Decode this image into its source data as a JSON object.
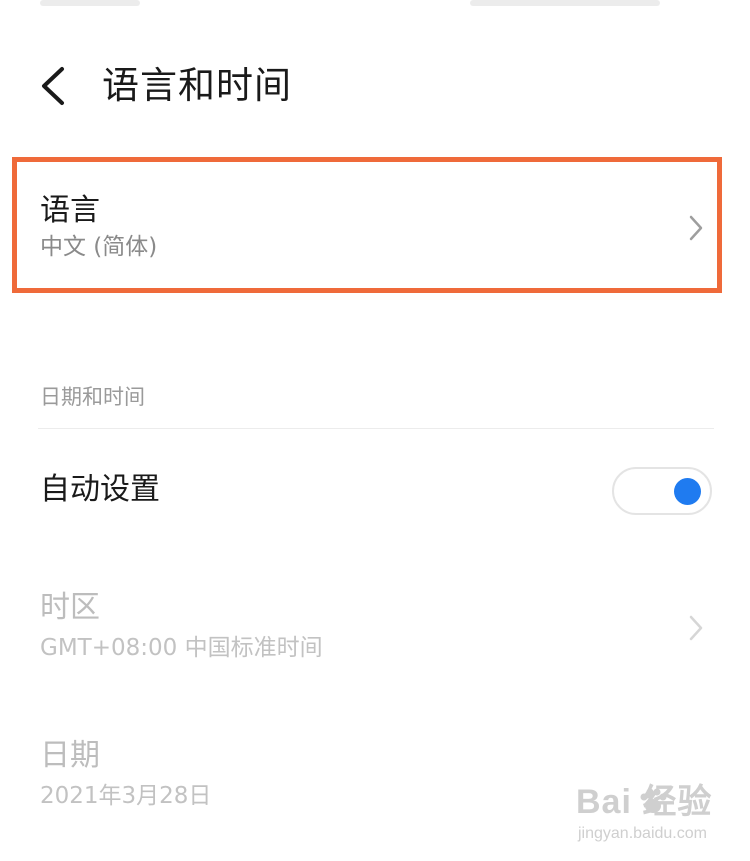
{
  "header": {
    "title": "语言和时间",
    "back_icon": "chevron-left-icon"
  },
  "language_row": {
    "title": "语言",
    "value": "中文 (简体)",
    "highlight_color": "#ef6a3a"
  },
  "date_time_section": {
    "label": "日期和时间",
    "auto_set": {
      "label": "自动设置",
      "enabled": true,
      "toggle_color": "#1f7bf0"
    },
    "timezone": {
      "title": "时区",
      "value": "GMT+08:00 中国标准时间"
    },
    "date": {
      "title": "日期",
      "value": "2021年3月28日"
    }
  },
  "watermark": {
    "logo": "Bai  经验",
    "url": "jingyan.baidu.com"
  }
}
